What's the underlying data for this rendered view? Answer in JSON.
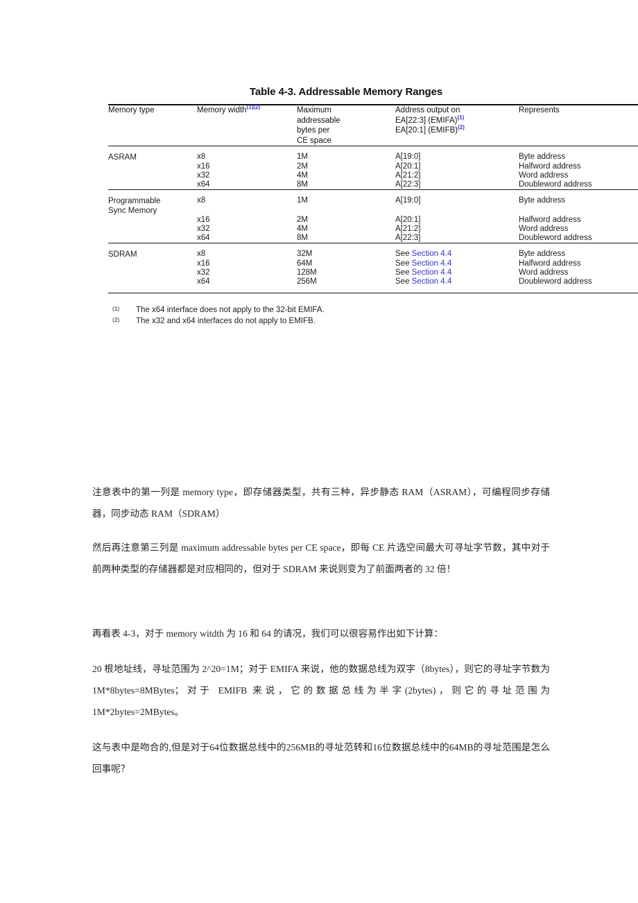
{
  "figure": {
    "title": "Table 4-3. Addressable Memory Ranges",
    "columns": {
      "memory_type": "Memory type",
      "memory_width": "Memory width",
      "memory_width_fn": "(1)(2)",
      "max_bytes_line1": "Maximum",
      "max_bytes_line2": "addressable",
      "max_bytes_line3": "bytes per",
      "max_bytes_line4": "CE space",
      "address_line1": "Address output on",
      "address_line2": "EA[22:3] (EMIFA)",
      "address_line2_fn": "(1)",
      "address_line3": "EA[20:1] (EMIFB)",
      "address_line3_fn": "(2)",
      "represents": "Represents"
    },
    "groups": [
      {
        "type": "ASRAM",
        "rows": [
          {
            "width": "x8",
            "bytes": "1M",
            "address_prefix": "",
            "address": "A[19:0]",
            "represents": "Byte address"
          },
          {
            "width": "x16",
            "bytes": "2M",
            "address_prefix": "",
            "address": "A[20:1]",
            "represents": "Halfword address"
          },
          {
            "width": "x32",
            "bytes": "4M",
            "address_prefix": "",
            "address": "A[21:2]",
            "represents": "Word address"
          },
          {
            "width": "x64",
            "bytes": "8M",
            "address_prefix": "",
            "address": "A[22:3]",
            "represents": "Doubleword address"
          }
        ]
      },
      {
        "type": "Programmable Sync Memory",
        "type_line1": "Programmable",
        "type_line2": "Sync Memory",
        "rows": [
          {
            "width": "x8",
            "bytes": "1M",
            "address_prefix": "",
            "address": "A[19:0]",
            "represents": "Byte address"
          },
          {
            "width": "x16",
            "bytes": "2M",
            "address_prefix": "",
            "address": "A[20:1]",
            "represents": "Halfword address"
          },
          {
            "width": "x32",
            "bytes": "4M",
            "address_prefix": "",
            "address": "A[21:2]",
            "represents": "Word address"
          },
          {
            "width": "x64",
            "bytes": "8M",
            "address_prefix": "",
            "address": "A[22:3]",
            "represents": "Doubleword address"
          }
        ]
      },
      {
        "type": "SDRAM",
        "rows": [
          {
            "width": "x8",
            "bytes": "32M",
            "address_prefix": "See ",
            "address": "Section 4.4",
            "represents": "Byte address"
          },
          {
            "width": "x16",
            "bytes": "64M",
            "address_prefix": "See ",
            "address": "Section 4.4",
            "represents": "Halfword address"
          },
          {
            "width": "x32",
            "bytes": "128M",
            "address_prefix": "See ",
            "address": "Section 4.4",
            "represents": "Word address"
          },
          {
            "width": "x64",
            "bytes": "256M",
            "address_prefix": "See ",
            "address": "Section 4.4",
            "represents": "Doubleword address"
          }
        ]
      }
    ],
    "footnotes": [
      {
        "marker": "(1)",
        "text": "The x64 interface does not apply to the 32-bit EMIFA."
      },
      {
        "marker": "(2)",
        "text": "The x32 and x64 interfaces do not apply to EMIFB."
      }
    ],
    "link_color": "#3333cc"
  },
  "article": {
    "paragraphs": [
      "注意表中的第一列是 memory type，即存储器类型，共有三种，异步静态 RAM（ASRAM），可编程同步存储器，同步动态 RAM（SDRAM）",
      "然后再注意第三列是 maximum addressable bytes per CE space，即每 CE 片选空间最大可寻址字节数，其中对于前两种类型的存储器都是对应相同的，但对于 SDRAM 来说则变为了前面两者的 32 倍！",
      "再看表 4-3，对于 memory witdth 为 16 和 64 的请况，我们可以很容易作出如下计算：",
      "20 根地址线，寻址范围为 2^20=1M；对于 EMIFA 来说，他的数据总线为双字（8bytes），则它的寻址字节数为 1M*8bytes=8MBytes；对于 EMIFB 来说，它的数据总线为半字(2bytes)，则它的寻址范围为 1M*2bytes=2MBytes。",
      "这与表中是吻合的,但是对于64位数据总线中的256MB的寻址范转和16位数据总线中的64MB的寻址范围是怎么回事呢？"
    ]
  }
}
